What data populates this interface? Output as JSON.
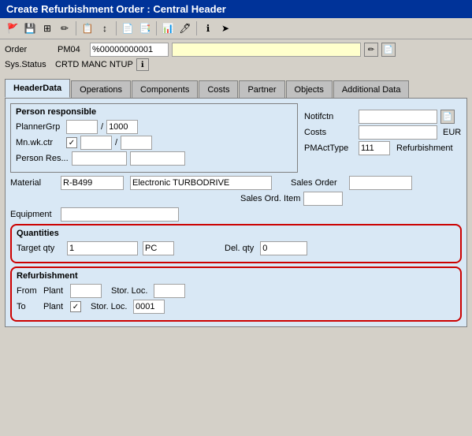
{
  "title_bar": {
    "text": "Create Refurbishment Order : Central Header"
  },
  "toolbar": {
    "buttons": [
      "💾",
      "📋",
      "🔍",
      "⚙️",
      "📑",
      "📄",
      "📊",
      "🖊️",
      "ℹ️",
      "➤"
    ]
  },
  "order_row": {
    "label": "Order",
    "value1": "PM04",
    "value2": "%00000000001",
    "value3": ""
  },
  "sys_status": {
    "label": "Sys.Status",
    "value": "CRTD  MANC  NTUP"
  },
  "tabs": [
    {
      "id": "headerdata",
      "label": "HeaderData",
      "active": true
    },
    {
      "id": "operations",
      "label": "Operations",
      "active": false
    },
    {
      "id": "components",
      "label": "Components",
      "active": false
    },
    {
      "id": "costs",
      "label": "Costs",
      "active": false
    },
    {
      "id": "partner",
      "label": "Partner",
      "active": false
    },
    {
      "id": "objects",
      "label": "Objects",
      "active": false
    },
    {
      "id": "additional_data",
      "label": "Additional Data",
      "active": false
    }
  ],
  "person_responsible": {
    "title": "Person responsible",
    "planner_grp_label": "PlannerGrp",
    "planner_grp_value1": "",
    "planner_grp_sep": "/",
    "planner_grp_value2": "1000",
    "mn_wk_ctr_label": "Mn.wk.ctr",
    "mn_wk_ctr_checked": "✓",
    "mn_wk_ctr_value2": "",
    "mn_wk_ctr_sep": "/",
    "mn_wk_ctr_value3": "",
    "person_res_label": "Person Res...",
    "person_res_value1": "",
    "person_res_value2": "",
    "notifctn_label": "Notifctn",
    "notifctn_value": "",
    "costs_label": "Costs",
    "costs_value": "",
    "costs_unit": "EUR",
    "pmact_label": "PMActType",
    "pmact_value": "111",
    "pmact_text": "Refurbishment"
  },
  "material_section": {
    "material_label": "Material",
    "material_value": "R-B499",
    "material_desc": "Electronic TURBODRIVE",
    "sales_order_label": "Sales Order",
    "sales_order_value": "",
    "sales_ord_item_label": "Sales Ord. Item",
    "sales_ord_item_value": "",
    "equipment_label": "Equipment",
    "equipment_value": ""
  },
  "quantities_section": {
    "title": "Quantities",
    "target_qty_label": "Target qty",
    "target_qty_value": "1",
    "target_qty_unit": "PC",
    "del_qty_label": "Del. qty",
    "del_qty_value": "0"
  },
  "refurbishment_section": {
    "title": "Refurbishment",
    "from_label": "From",
    "plant_label": "Plant",
    "from_plant_value": "",
    "stor_loc_label": "Stor. Loc.",
    "from_stor_loc_value": "",
    "to_label": "To",
    "to_plant_checked": "✓",
    "to_stor_loc_value": "0001"
  }
}
